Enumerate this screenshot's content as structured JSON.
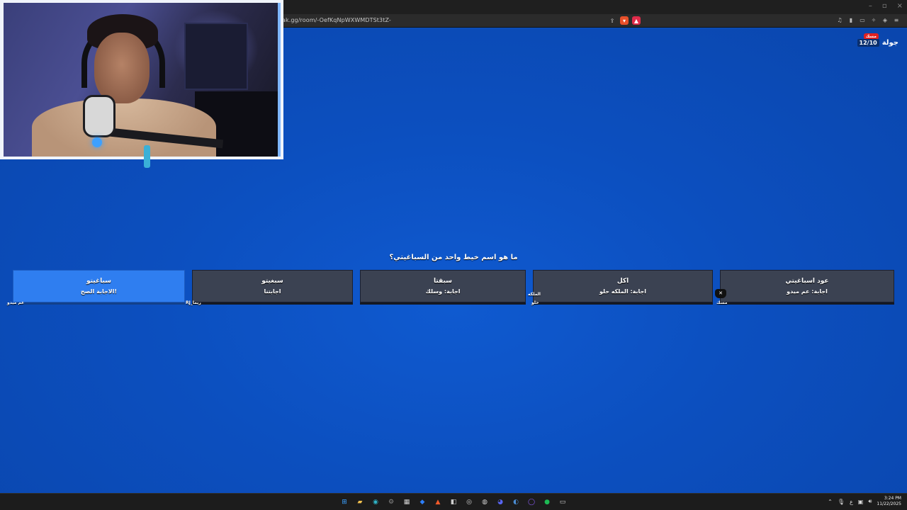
{
  "browser": {
    "url": "ak.gg/room/-OefKqNpWXWMDTSt3tZ-",
    "window_controls": [
      "–",
      "▫",
      "×"
    ]
  },
  "game": {
    "round_label": "جولة",
    "round_count": "12/10",
    "round_badge": "مسك",
    "question": "ما هو اسم خيط واحد من السباغيتي؟",
    "answers": [
      {
        "text": "سباغيتو",
        "sub": "الاجابة الصح!",
        "player": "عم ميدو",
        "correct": true
      },
      {
        "text": "سبغيتو",
        "sub": "اجابتنا",
        "player": "RJ_ريما",
        "correct": false
      },
      {
        "text": "سبقتا",
        "sub": "اجابة: وسلك",
        "player": "",
        "correct": false
      },
      {
        "text": "اكل",
        "sub": "اجابة: الملكه حلو",
        "player": "حلو",
        "player_above": "الملكه",
        "correct": false
      },
      {
        "text": "عود اسباغيتي",
        "sub": "اجابة: عم ميدو",
        "player": "مسك",
        "correct": false
      }
    ]
  },
  "taskbar": {
    "apps": [
      {
        "icon": "windows-start-icon",
        "glyph": "⊞",
        "color": "#3aa0ff"
      },
      {
        "icon": "file-explorer-icon",
        "glyph": "▰",
        "color": "#f2c14e"
      },
      {
        "icon": "edge-browser-icon",
        "glyph": "◉",
        "color": "#2fb5c9"
      },
      {
        "icon": "settings-icon",
        "glyph": "⚙",
        "color": "#8a8a8a"
      },
      {
        "icon": "calendar-icon",
        "glyph": "▦",
        "color": "#d0d0d0"
      },
      {
        "icon": "defender-icon",
        "glyph": "◆",
        "color": "#2d7ff9"
      },
      {
        "icon": "brave-browser-icon",
        "glyph": "▲",
        "color": "#f25a2a"
      },
      {
        "icon": "app-icon",
        "glyph": "◧",
        "color": "#cfcfcf"
      },
      {
        "icon": "obs-icon",
        "glyph": "◎",
        "color": "#cfcfcf"
      },
      {
        "icon": "chrome-icon",
        "glyph": "◍",
        "color": "#cfcfcf"
      },
      {
        "icon": "discord-icon",
        "glyph": "◕",
        "color": "#5865f2"
      },
      {
        "icon": "steam-icon",
        "glyph": "◐",
        "color": "#4a8bd1"
      },
      {
        "icon": "browser-icon",
        "glyph": "◯",
        "color": "#8a5cf5"
      },
      {
        "icon": "spotify-icon",
        "glyph": "●",
        "color": "#1db954"
      },
      {
        "icon": "app-extra-icon",
        "glyph": "▭",
        "color": "#cfcfcf"
      }
    ],
    "tray": {
      "language": "ع",
      "time": "3:24 PM",
      "date": "11/22/2025"
    }
  }
}
